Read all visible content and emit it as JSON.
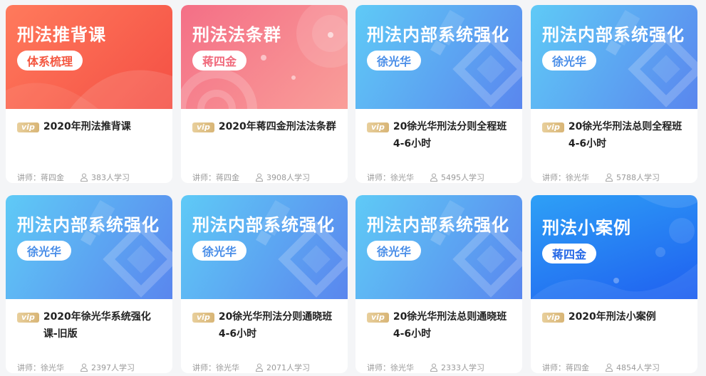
{
  "teacher_prefix": "讲师：",
  "vip_label": "vip",
  "colors": {
    "red": "#fd6a5b",
    "pink": "#f7848f",
    "blue": "#5a9df3",
    "deep_blue": "#2e7bf5"
  },
  "cards": [
    {
      "banner_title": "刑法推背课",
      "banner_pill": "体系梳理",
      "theme": "red",
      "course_title": "2020年刑法推背课",
      "teacher": "蒋四金",
      "students": "383人学习"
    },
    {
      "banner_title": "刑法法条群",
      "banner_pill": "蒋四金",
      "theme": "pink",
      "course_title": "2020年蒋四金刑法法条群",
      "teacher": "蒋四金",
      "students": "3908人学习"
    },
    {
      "banner_title": "刑法内部系统强化",
      "banner_pill": "徐光华",
      "theme": "blue",
      "course_title": "20徐光华刑法分则全程班4-6小时",
      "teacher": "徐光华",
      "students": "5495人学习"
    },
    {
      "banner_title": "刑法内部系统强化",
      "banner_pill": "徐光华",
      "theme": "blue",
      "course_title": "20徐光华刑法总则全程班4-6小时",
      "teacher": "徐光华",
      "students": "5788人学习"
    },
    {
      "banner_title": "刑法内部系统强化",
      "banner_pill": "徐光华",
      "theme": "blue",
      "course_title": "2020年徐光华系统强化课-旧版",
      "teacher": "徐光华",
      "students": "2397人学习"
    },
    {
      "banner_title": "刑法内部系统强化",
      "banner_pill": "徐光华",
      "theme": "blue",
      "course_title": "20徐光华刑法分则通晓班4-6小时",
      "teacher": "徐光华",
      "students": "2071人学习"
    },
    {
      "banner_title": "刑法内部系统强化",
      "banner_pill": "徐光华",
      "theme": "blue",
      "course_title": "20徐光华刑法总则通晓班4-6小时",
      "teacher": "徐光华",
      "students": "2333人学习"
    },
    {
      "banner_title": "刑法小案例",
      "banner_pill": "蒋四金",
      "theme": "deep_blue",
      "course_title": "2020年刑法小案例",
      "teacher": "蒋四金",
      "students": "4854人学习"
    }
  ]
}
